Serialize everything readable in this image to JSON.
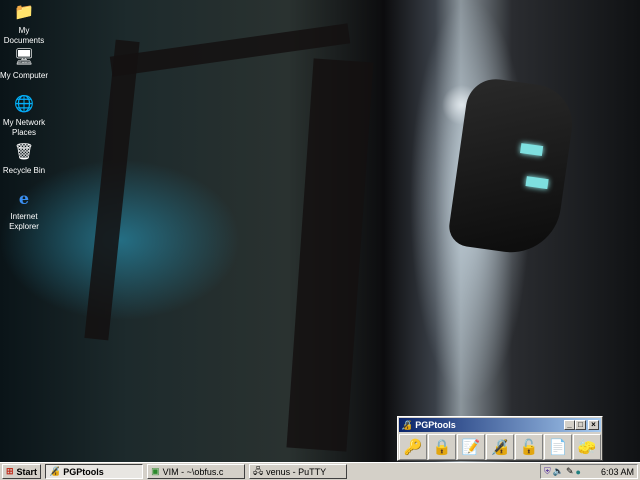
{
  "desktop": {
    "icons": [
      {
        "label": "My Documents",
        "icon": "folder-icon"
      },
      {
        "label": "My Computer",
        "icon": "computer-icon"
      },
      {
        "label": "My Network Places",
        "icon": "network-icon"
      },
      {
        "label": "Recycle Bin",
        "icon": "recycle-bin-icon"
      },
      {
        "label": "Internet Explorer",
        "icon": "ie-icon"
      }
    ]
  },
  "window": {
    "title": "PGPtools",
    "minimize": "_",
    "maximize": "□",
    "close": "×",
    "tools": [
      "keys",
      "encrypt",
      "sign",
      "encrypt-sign",
      "decrypt-verify",
      "wipe",
      "freespace-wipe"
    ]
  },
  "taskbar": {
    "start": "Start",
    "tasks": [
      {
        "label": "PGPtools",
        "active": true
      },
      {
        "label": "VIM - ~\\obfus.c",
        "active": false
      },
      {
        "label": "venus - PuTTY",
        "active": false
      }
    ],
    "clock": "6:03 AM"
  },
  "colors": {
    "titlebar": "#0a246a",
    "face": "#d4d0c8"
  }
}
